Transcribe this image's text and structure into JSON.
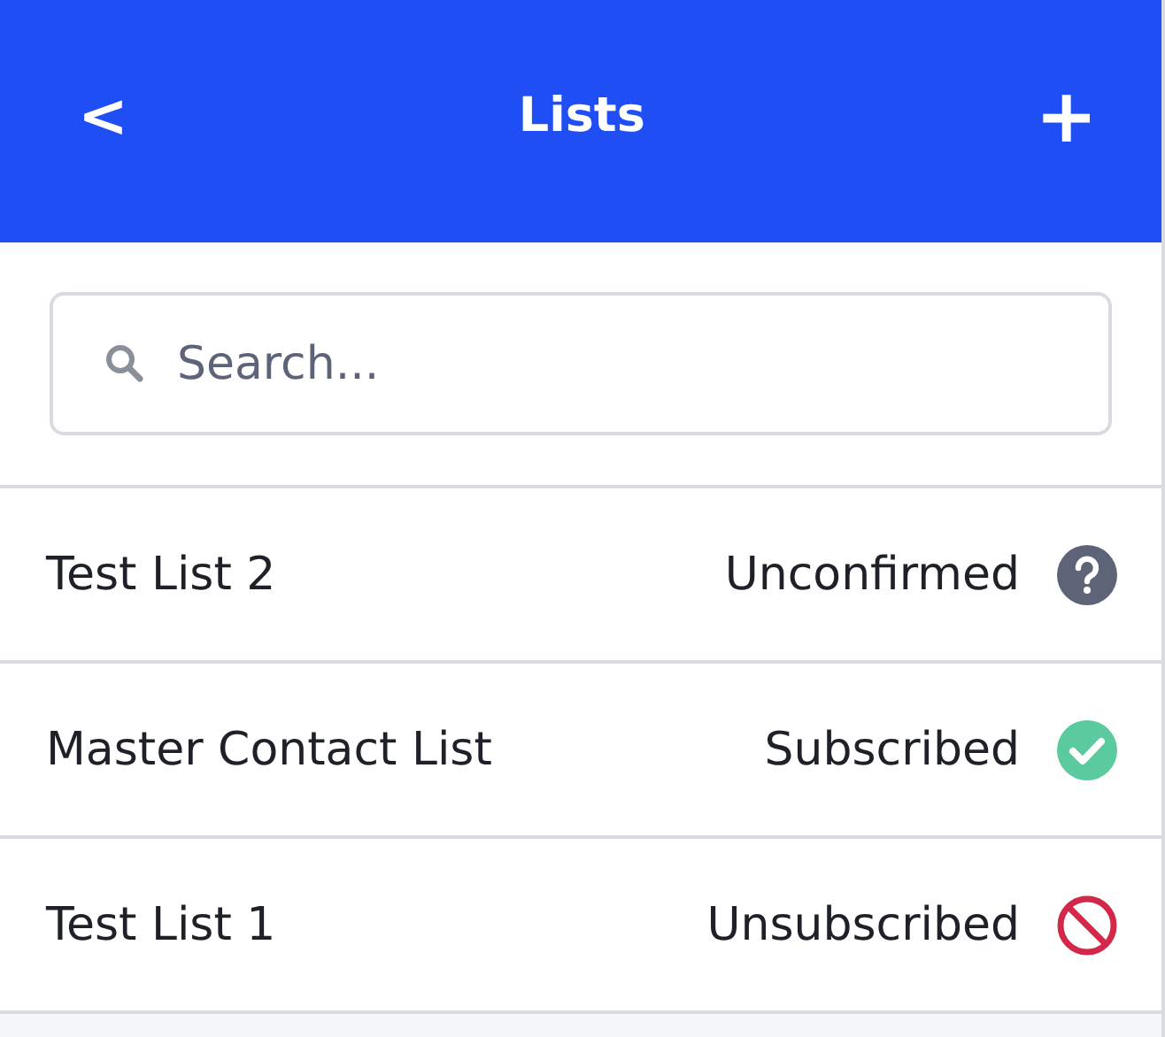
{
  "header": {
    "back": "<",
    "title": "Lists",
    "add": "+"
  },
  "search": {
    "placeholder": "Search..."
  },
  "lists": [
    {
      "name": "Test List 2",
      "status": "Unconfirmed",
      "kind": "unconfirmed"
    },
    {
      "name": "Master Contact List",
      "status": "Subscribed",
      "kind": "subscribed"
    },
    {
      "name": "Test List 1",
      "status": "Unsubscribed",
      "kind": "unsubscribed"
    }
  ]
}
